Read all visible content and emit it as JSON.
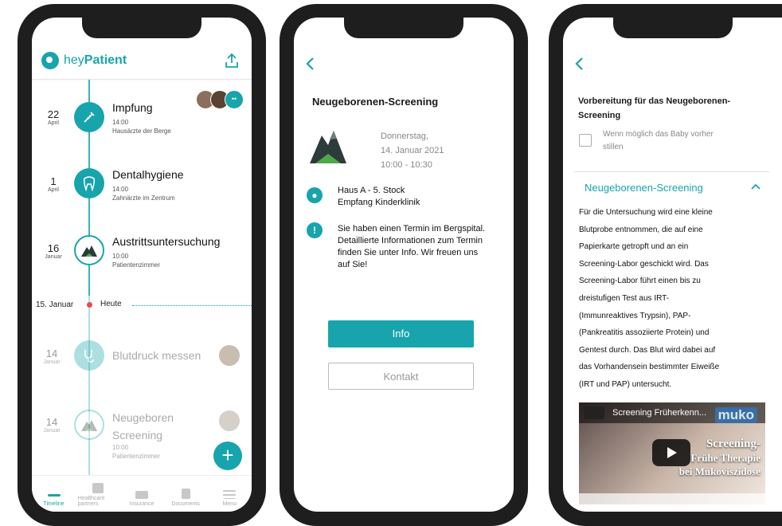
{
  "timeline_screen": {
    "brand": {
      "prefix": "hey",
      "name": "Patient"
    },
    "events": [
      {
        "day": "22",
        "month": "April",
        "title": "Impfung",
        "time": "14:00",
        "place": "Hausärzte der Berge",
        "icon": "syringe-icon"
      },
      {
        "day": "1",
        "month": "April",
        "title": "Dentalhygiene",
        "time": "14:00",
        "place": "Zahnärzte im Zentrum",
        "icon": "tooth-icon"
      },
      {
        "day": "16",
        "month": "Januar",
        "title": "Austrittsuntersuchung",
        "time": "10:00",
        "place": "Patientenzimmer",
        "icon": "mountain-icon"
      }
    ],
    "today_marker": {
      "date": "15. Januar",
      "label": "Heute"
    },
    "future_events": [
      {
        "day": "14",
        "month": "Januar",
        "title": "Blutdruck messen",
        "icon": "stethoscope-icon"
      },
      {
        "day": "14",
        "month": "Januar",
        "title_line1": "Neugeboren",
        "title_line2": "Screening",
        "time": "10:00",
        "place": "Patientenzimmer",
        "icon": "mountain-icon"
      }
    ],
    "tabs": [
      {
        "label": "Timeline",
        "active": true
      },
      {
        "label": "Healthcare partners",
        "active": false
      },
      {
        "label": "Insurance",
        "active": false
      },
      {
        "label": "Documents",
        "active": false
      },
      {
        "label": "Menu",
        "active": false
      }
    ],
    "accent": "#18a4ac"
  },
  "detail_screen": {
    "title": "Neugeborenen-Screening",
    "date_line1": "Donnerstag,",
    "date_line2": "14. Januar 2021",
    "time_range": "10:00 - 10:30",
    "location_line1": "Haus A - 5. Stock",
    "location_line2": "Empfang Kinderklinik",
    "info_text": "Sie haben einen Termin im Bergspital. Detaillierte Informationen zum Termin finden Sie unter Info. Wir freuen uns auf Sie!",
    "primary_button": "Info",
    "secondary_button": "Kontakt"
  },
  "info_screen": {
    "prep_title_line1": "Vorbereitung für das Neugeborenen-",
    "prep_title_line2": "Screening",
    "checkbox_line1": "Wenn möglich das Baby vorher",
    "checkbox_line2": "stillen",
    "section_title": "Neugeborenen-Screening",
    "body_lines": [
      "Für die Untersuchung wird eine kleine",
      "Blutprobe entnommen, die auf eine",
      "Papierkarte getropft und an ein",
      "Screening-Labor geschickt wird. Das",
      "Screening-Labor führt einen bis zu",
      "dreistufigen Test aus IRT-",
      "(Immunreaktives Trypsin), PAP-",
      "(Pankreatitis assoziierte Protein) und",
      "Gentest durch. Das Blut wird dabei auf",
      "das Vorhandensein bestimmter Eiweiße",
      "(IRT und PAP) untersucht."
    ],
    "video": {
      "title": "Screening Früherkenn...",
      "overlay_line1": "Screening-",
      "overlay_line2": "Frühe Therapie",
      "overlay_line3": "bei Mukoviszidose",
      "brand": "muko"
    }
  }
}
